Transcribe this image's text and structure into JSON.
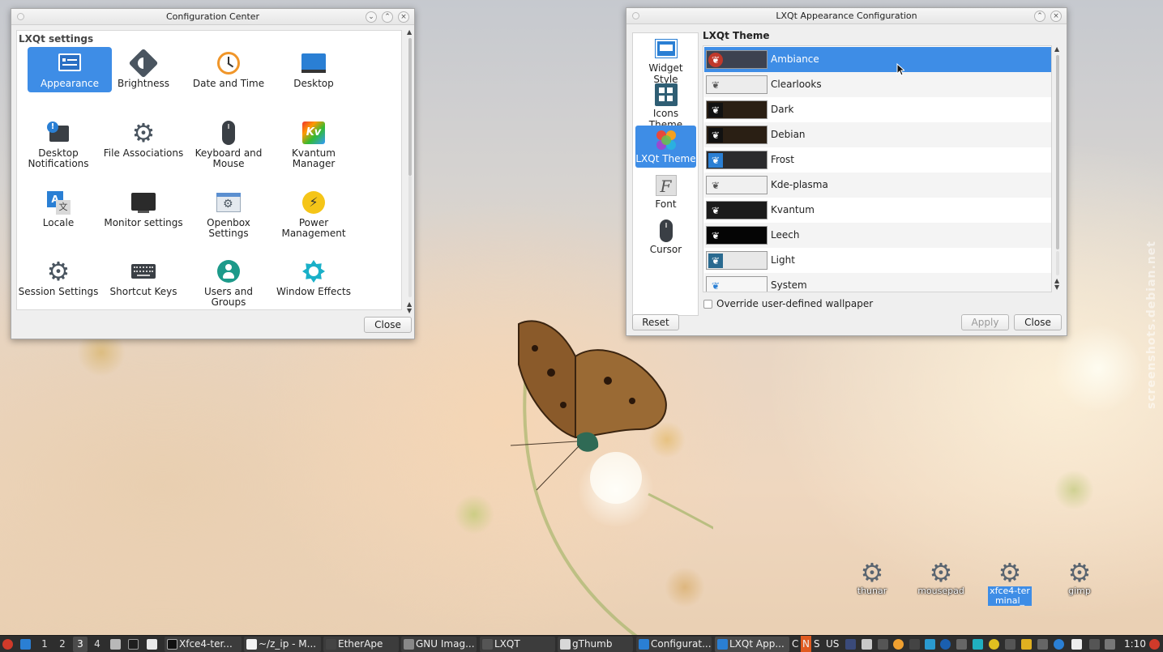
{
  "config_center": {
    "title": "Configuration Center",
    "section": "LXQt settings",
    "items": [
      {
        "label": "Appearance",
        "icon": "appearance-icon"
      },
      {
        "label": "Brightness",
        "icon": "brightness-icon"
      },
      {
        "label": "Date and Time",
        "icon": "clock-icon"
      },
      {
        "label": "Desktop",
        "icon": "desktop-icon"
      },
      {
        "label": "Desktop Notifications",
        "icon": "notification-icon"
      },
      {
        "label": "File Associations",
        "icon": "gear-icon"
      },
      {
        "label": "Keyboard and Mouse",
        "icon": "mouse-icon"
      },
      {
        "label": "Kvantum Manager",
        "icon": "kvantum-icon"
      },
      {
        "label": "Locale",
        "icon": "locale-icon"
      },
      {
        "label": "Monitor settings",
        "icon": "monitor-icon"
      },
      {
        "label": "Openbox Settings",
        "icon": "openbox-icon"
      },
      {
        "label": "Power Management",
        "icon": "power-icon"
      },
      {
        "label": "Session Settings",
        "icon": "gear-icon"
      },
      {
        "label": "Shortcut Keys",
        "icon": "keyboard-icon"
      },
      {
        "label": "Users and Groups",
        "icon": "user-icon"
      },
      {
        "label": "Window Effects",
        "icon": "effects-icon"
      }
    ],
    "close_label": "Close"
  },
  "appearance": {
    "title": "LXQt Appearance Configuration",
    "sidebar": [
      {
        "label": "Widget Style",
        "icon": "widget-style-icon"
      },
      {
        "label": "Icons Theme",
        "icon": "icons-theme-icon"
      },
      {
        "label": "LXQt Theme",
        "icon": "lxqt-theme-icon"
      },
      {
        "label": "Font",
        "icon": "font-icon"
      },
      {
        "label": "Cursor",
        "icon": "cursor-icon"
      }
    ],
    "heading": "LXQt Theme",
    "themes": [
      {
        "name": "Ambiance",
        "thumb": "#3d4250"
      },
      {
        "name": "Clearlooks",
        "thumb": "#ececec"
      },
      {
        "name": "Dark",
        "thumb": "#2a1f14"
      },
      {
        "name": "Debian",
        "thumb": "#2a1f14"
      },
      {
        "name": "Frost",
        "thumb": "#2b2b2d"
      },
      {
        "name": "Kde-plasma",
        "thumb": "#f0f0f0"
      },
      {
        "name": "Kvantum",
        "thumb": "#1a1a1a"
      },
      {
        "name": "Leech",
        "thumb": "#050505"
      },
      {
        "name": "Light",
        "thumb": "#e8e8e8"
      },
      {
        "name": "System",
        "thumb": "#f6f6f6"
      }
    ],
    "override_label": "Override user-defined wallpaper",
    "reset_label": "Reset",
    "apply_label": "Apply",
    "close_label": "Close"
  },
  "desktop_icons": [
    {
      "label": "thunar"
    },
    {
      "label": "mousepad"
    },
    {
      "label": "xfce4-terminal_"
    },
    {
      "label": "gimp"
    }
  ],
  "watermark": "screenshots.debian.net",
  "taskbar": {
    "desktops": [
      "1",
      "2",
      "3",
      "4"
    ],
    "tasks": [
      {
        "label": "Xfce4-ter..."
      },
      {
        "label": "~/z_ip - M..."
      },
      {
        "label": "EtherApe"
      },
      {
        "label": "GNU Imag..."
      },
      {
        "label": "LXQT"
      },
      {
        "label": "gThumb"
      },
      {
        "label": "Configurat..."
      },
      {
        "label": "LXQt App..."
      }
    ],
    "kbd": [
      "C",
      "N",
      "S"
    ],
    "layout": "US",
    "clock": "1:10"
  },
  "colors": {
    "selection": "#3e8de6",
    "taskbar": "#2e2e2e",
    "icon_gray": "#4a5560",
    "icon_blue": "#2a7fd4"
  }
}
